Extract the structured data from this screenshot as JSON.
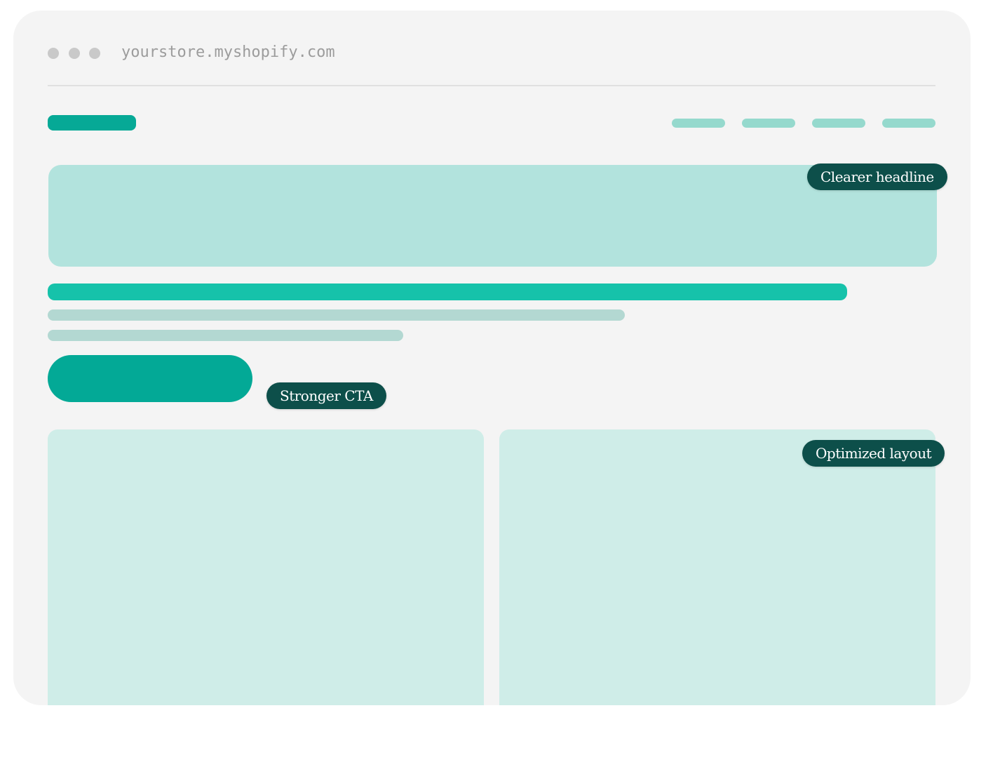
{
  "browser": {
    "url": "yourstore.myshopify.com"
  },
  "annotations": {
    "headline": "Clearer headline",
    "cta": "Stronger CTA",
    "layout": "Optimized layout"
  },
  "colors": {
    "window_bg": "#f4f4f4",
    "accent": "#06a996",
    "hero_block": "#b2e3dd",
    "headline_bar": "#16c2aa",
    "nav_placeholder": "#95d9cd",
    "text_placeholder": "#b3d8d2",
    "card_block": "#cfede8",
    "tag_bg": "#0d4f4a",
    "window_dot": "#c9c9c9"
  }
}
